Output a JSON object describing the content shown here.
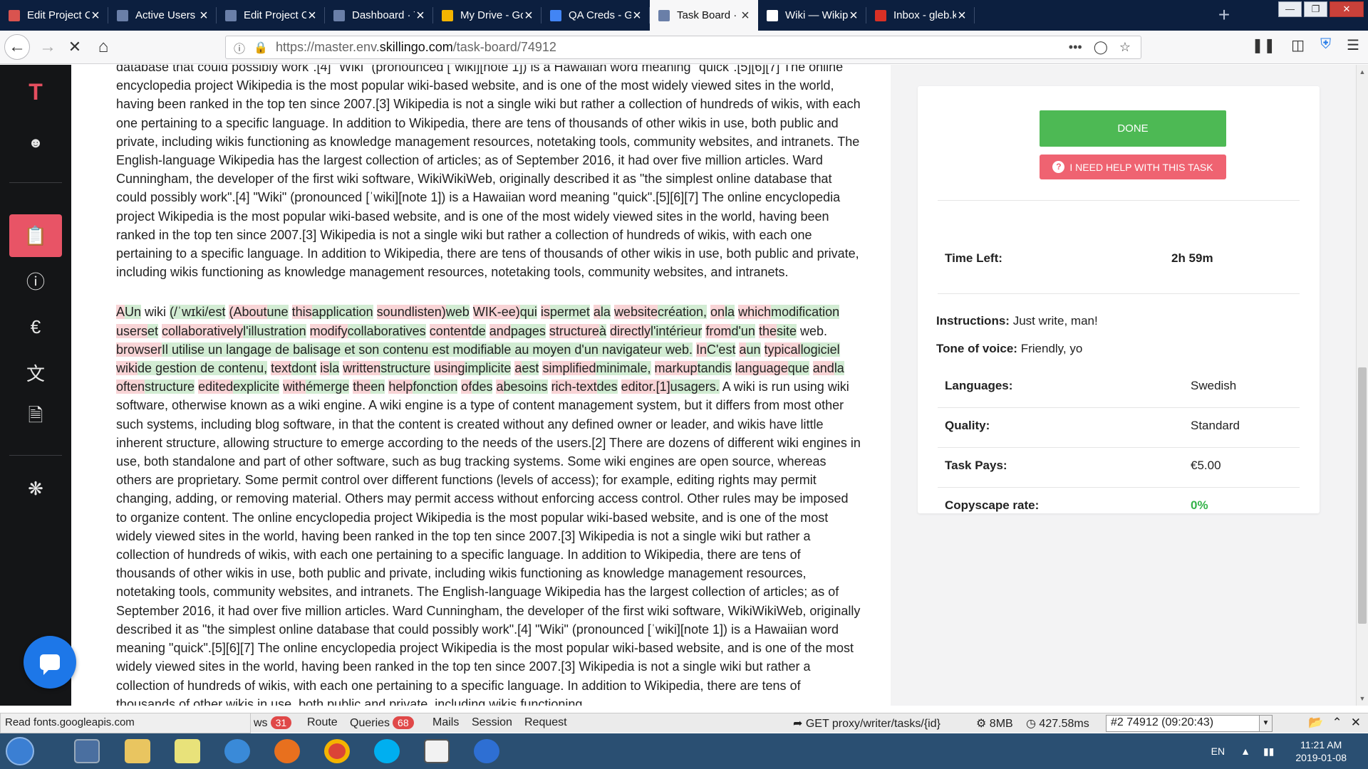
{
  "browser": {
    "tabs": [
      {
        "title": "Edit Project Cont",
        "favicon": "skillingo-icon",
        "color": "#d9534f"
      },
      {
        "title": "Active Users",
        "favicon": "dot-icon",
        "color": "#6a7fa8"
      },
      {
        "title": "Edit Project Cont",
        "favicon": "dot-icon",
        "color": "#6a7fa8"
      },
      {
        "title": "Dashboard · Top",
        "favicon": "dot-icon",
        "color": "#6a7fa8"
      },
      {
        "title": "My Drive - Goog",
        "favicon": "drive-icon",
        "color": "#f4b400"
      },
      {
        "title": "QA Creds - Goog",
        "favicon": "sheets-icon",
        "color": "#4285f4"
      },
      {
        "title": "Task Board · Top",
        "favicon": "dot-icon",
        "color": "#6a7fa8",
        "active": true
      },
      {
        "title": "Wiki — Wikipédi",
        "favicon": "wikipedia-icon",
        "color": "#ffffff"
      },
      {
        "title": "Inbox - gleb.klim",
        "favicon": "gmail-icon",
        "color": "#d93025"
      }
    ],
    "url_prefix": "https://master.env.",
    "url_domain": "skillingo.com",
    "url_path": "/task-board/74912"
  },
  "article": {
    "para1": "database that could possibly work\".[4] \"Wiki\" (pronounced [ˈwiki][note 1]) is a Hawaiian word meaning \"quick\".[5][6][7] The online encyclopedia project Wikipedia is the most popular wiki-based website, and is one of the most widely viewed sites in the world, having been ranked in the top ten since 2007.[3] Wikipedia is not a single wiki but rather a collection of hundreds of wikis, with each one pertaining to a specific language. In addition to Wikipedia, there are tens of thousands of other wikis in use, both public and private, including wikis functioning as knowledge management resources, notetaking tools, community websites, and intranets. The English-language Wikipedia has the largest collection of articles; as of September 2016, it had over five million articles. Ward Cunningham, the developer of the first wiki software, WikiWikiWeb, originally described it as \"the simplest online database that could possibly work\".[4] \"Wiki\" (pronounced [ˈwiki][note 1]) is a Hawaiian word meaning \"quick\".[5][6][7] The online encyclopedia project Wikipedia is the most popular wiki-based website, and is one of the most widely viewed sites in the world, having been ranked in the top ten since 2007.[3] Wikipedia is not a single wiki but rather a collection of hundreds of wikis, with each one pertaining to a specific language. In addition to Wikipedia, there are tens of thousands of other wikis in use, both public and private, including wikis functioning as knowledge management resources, notetaking tools, community websites, and intranets.",
    "diff": [
      {
        "t": "del",
        "s": "A"
      },
      {
        "t": "ins",
        "s": "Un"
      },
      {
        "t": "eq",
        "s": " wiki "
      },
      {
        "t": "ins",
        "s": "(/ˈwɪki/est"
      },
      {
        "t": "eq",
        "s": " "
      },
      {
        "t": "del",
        "s": "(About"
      },
      {
        "t": "ins",
        "s": "une"
      },
      {
        "t": "eq",
        "s": " "
      },
      {
        "t": "del",
        "s": "this"
      },
      {
        "t": "ins",
        "s": "application"
      },
      {
        "t": "eq",
        "s": " "
      },
      {
        "t": "del",
        "s": "soundlisten)"
      },
      {
        "t": "ins",
        "s": "web"
      },
      {
        "t": "eq",
        "s": " "
      },
      {
        "t": "del",
        "s": "WIK-ee)"
      },
      {
        "t": "ins",
        "s": "qui"
      },
      {
        "t": "eq",
        "s": " "
      },
      {
        "t": "del",
        "s": "is"
      },
      {
        "t": "ins",
        "s": "permet"
      },
      {
        "t": "eq",
        "s": " "
      },
      {
        "t": "del",
        "s": "a"
      },
      {
        "t": "ins",
        "s": "la"
      },
      {
        "t": "eq",
        "s": " "
      },
      {
        "t": "del",
        "s": "website"
      },
      {
        "t": "ins",
        "s": "création,"
      },
      {
        "t": "eq",
        "s": " "
      },
      {
        "t": "del",
        "s": "on"
      },
      {
        "t": "ins",
        "s": "la"
      },
      {
        "t": "eq",
        "s": " "
      },
      {
        "t": "del",
        "s": "which"
      },
      {
        "t": "ins",
        "s": "modification"
      },
      {
        "t": "eq",
        "s": " "
      },
      {
        "t": "del",
        "s": "users"
      },
      {
        "t": "ins",
        "s": "et"
      },
      {
        "t": "eq",
        "s": " "
      },
      {
        "t": "del",
        "s": "collaboratively"
      },
      {
        "t": "ins",
        "s": "l'illustration"
      },
      {
        "t": "eq",
        "s": " "
      },
      {
        "t": "del",
        "s": "modify"
      },
      {
        "t": "ins",
        "s": "collaboratives"
      },
      {
        "t": "eq",
        "s": " "
      },
      {
        "t": "del",
        "s": "content"
      },
      {
        "t": "ins",
        "s": "de"
      },
      {
        "t": "eq",
        "s": " "
      },
      {
        "t": "del",
        "s": "and"
      },
      {
        "t": "ins",
        "s": "pages"
      },
      {
        "t": "eq",
        "s": " "
      },
      {
        "t": "del",
        "s": "structure"
      },
      {
        "t": "ins",
        "s": "à"
      },
      {
        "t": "eq",
        "s": " "
      },
      {
        "t": "del",
        "s": "directly"
      },
      {
        "t": "ins",
        "s": "l'intérieur"
      },
      {
        "t": "eq",
        "s": " "
      },
      {
        "t": "del",
        "s": "from"
      },
      {
        "t": "ins",
        "s": "d'un"
      },
      {
        "t": "eq",
        "s": " "
      },
      {
        "t": "del",
        "s": "the"
      },
      {
        "t": "ins",
        "s": "site"
      },
      {
        "t": "eq",
        "s": " web. "
      },
      {
        "t": "del",
        "s": "browser"
      },
      {
        "t": "ins",
        "s": "Il utilise un langage de balisage et son contenu est modifiable au moyen d'un navigateur web."
      },
      {
        "t": "eq",
        "s": " "
      },
      {
        "t": "del",
        "s": "In"
      },
      {
        "t": "ins",
        "s": "C'est"
      },
      {
        "t": "eq",
        "s": " "
      },
      {
        "t": "del",
        "s": "a"
      },
      {
        "t": "ins",
        "s": "un"
      },
      {
        "t": "eq",
        "s": " "
      },
      {
        "t": "del",
        "s": "typical"
      },
      {
        "t": "ins",
        "s": "logiciel"
      },
      {
        "t": "eq",
        "s": " "
      },
      {
        "t": "del",
        "s": "wiki"
      },
      {
        "t": "ins",
        "s": "de gestion de contenu,"
      },
      {
        "t": "eq",
        "s": " "
      },
      {
        "t": "del",
        "s": "text"
      },
      {
        "t": "ins",
        "s": "dont"
      },
      {
        "t": "eq",
        "s": " "
      },
      {
        "t": "del",
        "s": "is"
      },
      {
        "t": "ins",
        "s": "la"
      },
      {
        "t": "eq",
        "s": " "
      },
      {
        "t": "del",
        "s": "written"
      },
      {
        "t": "ins",
        "s": "structure"
      },
      {
        "t": "eq",
        "s": " "
      },
      {
        "t": "del",
        "s": "using"
      },
      {
        "t": "ins",
        "s": "implicite"
      },
      {
        "t": "eq",
        "s": " "
      },
      {
        "t": "del",
        "s": "a"
      },
      {
        "t": "ins",
        "s": "est"
      },
      {
        "t": "eq",
        "s": " "
      },
      {
        "t": "del",
        "s": "simplified"
      },
      {
        "t": "ins",
        "s": "minimale,"
      },
      {
        "t": "eq",
        "s": " "
      },
      {
        "t": "del",
        "s": "markup"
      },
      {
        "t": "ins",
        "s": "tandis"
      },
      {
        "t": "eq",
        "s": " "
      },
      {
        "t": "del",
        "s": "language"
      },
      {
        "t": "ins",
        "s": "que"
      },
      {
        "t": "eq",
        "s": " "
      },
      {
        "t": "del",
        "s": "and"
      },
      {
        "t": "ins",
        "s": "la"
      },
      {
        "t": "eq",
        "s": " "
      },
      {
        "t": "del",
        "s": "often"
      },
      {
        "t": "ins",
        "s": "structure"
      },
      {
        "t": "eq",
        "s": " "
      },
      {
        "t": "del",
        "s": "edited"
      },
      {
        "t": "ins",
        "s": "explicite"
      },
      {
        "t": "eq",
        "s": " "
      },
      {
        "t": "del",
        "s": "with"
      },
      {
        "t": "ins",
        "s": "émerge"
      },
      {
        "t": "eq",
        "s": " "
      },
      {
        "t": "del",
        "s": "the"
      },
      {
        "t": "ins",
        "s": "en"
      },
      {
        "t": "eq",
        "s": " "
      },
      {
        "t": "del",
        "s": "help"
      },
      {
        "t": "ins",
        "s": "fonction"
      },
      {
        "t": "eq",
        "s": " "
      },
      {
        "t": "del",
        "s": "of"
      },
      {
        "t": "ins",
        "s": "des"
      },
      {
        "t": "eq",
        "s": " "
      },
      {
        "t": "del",
        "s": "a"
      },
      {
        "t": "ins",
        "s": "besoins"
      },
      {
        "t": "eq",
        "s": " "
      },
      {
        "t": "del",
        "s": "rich-text"
      },
      {
        "t": "ins",
        "s": "des"
      },
      {
        "t": "eq",
        "s": " "
      },
      {
        "t": "del",
        "s": "editor.[1]"
      },
      {
        "t": "ins",
        "s": "usagers."
      }
    ],
    "para2_rest": " A wiki is run using wiki software, otherwise known as a wiki engine. A wiki engine is a type of content management system, but it differs from most other such systems, including blog software, in that the content is created without any defined owner or leader, and wikis have little inherent structure, allowing structure to emerge according to the needs of the users.[2] There are dozens of different wiki engines in use, both standalone and part of other software, such as bug tracking systems. Some wiki engines are open source, whereas others are proprietary. Some permit control over different functions (levels of access); for example, editing rights may permit changing, adding, or removing material. Others may permit access without enforcing access control. Other rules may be imposed to organize content. The online encyclopedia project Wikipedia is the most popular wiki-based website, and is one of the most widely viewed sites in the world, having been ranked in the top ten since 2007.[3] Wikipedia is not a single wiki but rather a collection of hundreds of wikis, with each one pertaining to a specific language. In addition to Wikipedia, there are tens of thousands of other wikis in use, both public and private, including wikis functioning as knowledge management resources, notetaking tools, community websites, and intranets. The English-language Wikipedia has the largest collection of articles; as of September 2016, it had over five million articles. Ward Cunningham, the developer of the first wiki software, WikiWikiWeb, originally described it as \"the simplest online database that could possibly work\".[4] \"Wiki\" (pronounced [ˈwiki][note 1]) is a Hawaiian word meaning \"quick\".[5][6][7] The online encyclopedia project Wikipedia is the most popular wiki-based website, and is one of the most widely viewed sites in the world, having been ranked in the top ten since 2007.[3] Wikipedia is not a single wiki but rather a collection of hundreds of wikis, with each one pertaining to a specific language. In addition to Wikipedia, there are tens of thousands of other wikis in use, both public and private, including wikis functioning"
  },
  "panel": {
    "done_label": "DONE",
    "help_label": "I NEED HELP WITH THIS TASK",
    "time_left_label": "Time Left:",
    "time_left_value": "2h 59m",
    "instructions_label": "Instructions:",
    "instructions_value": "Just write, man!",
    "tone_label": "Tone of voice:",
    "tone_value": "Friendly, yo",
    "languages_label": "Languages:",
    "languages_value": "Swedish",
    "quality_label": "Quality:",
    "quality_value": "Standard",
    "pays_label": "Task Pays:",
    "pays_value": "€5.00",
    "copyscape_label": "Copyscape rate:",
    "copyscape_value": "0%"
  },
  "debug": {
    "status_text": "Read fonts.googleapis.com",
    "tab_ws": "ws",
    "ws_count": "31",
    "tab_route": "Route",
    "tab_queries": "Queries",
    "queries_count": "68",
    "tab_mails": "Mails",
    "tab_session": "Session",
    "tab_request": "Request",
    "request_info": "GET proxy/writer/tasks/{id}",
    "memory": "8MB",
    "time": "427.58ms",
    "selected_request": "#2 74912 (09:20:43)"
  },
  "taskbar": {
    "lang": "EN",
    "time": "11:21 AM",
    "date": "2019-01-08"
  },
  "colors": {
    "accent": "#e85466",
    "done": "#4db954",
    "help": "#ef6371",
    "deletion": "#f8d4d6",
    "insertion": "#d2ecd3"
  }
}
